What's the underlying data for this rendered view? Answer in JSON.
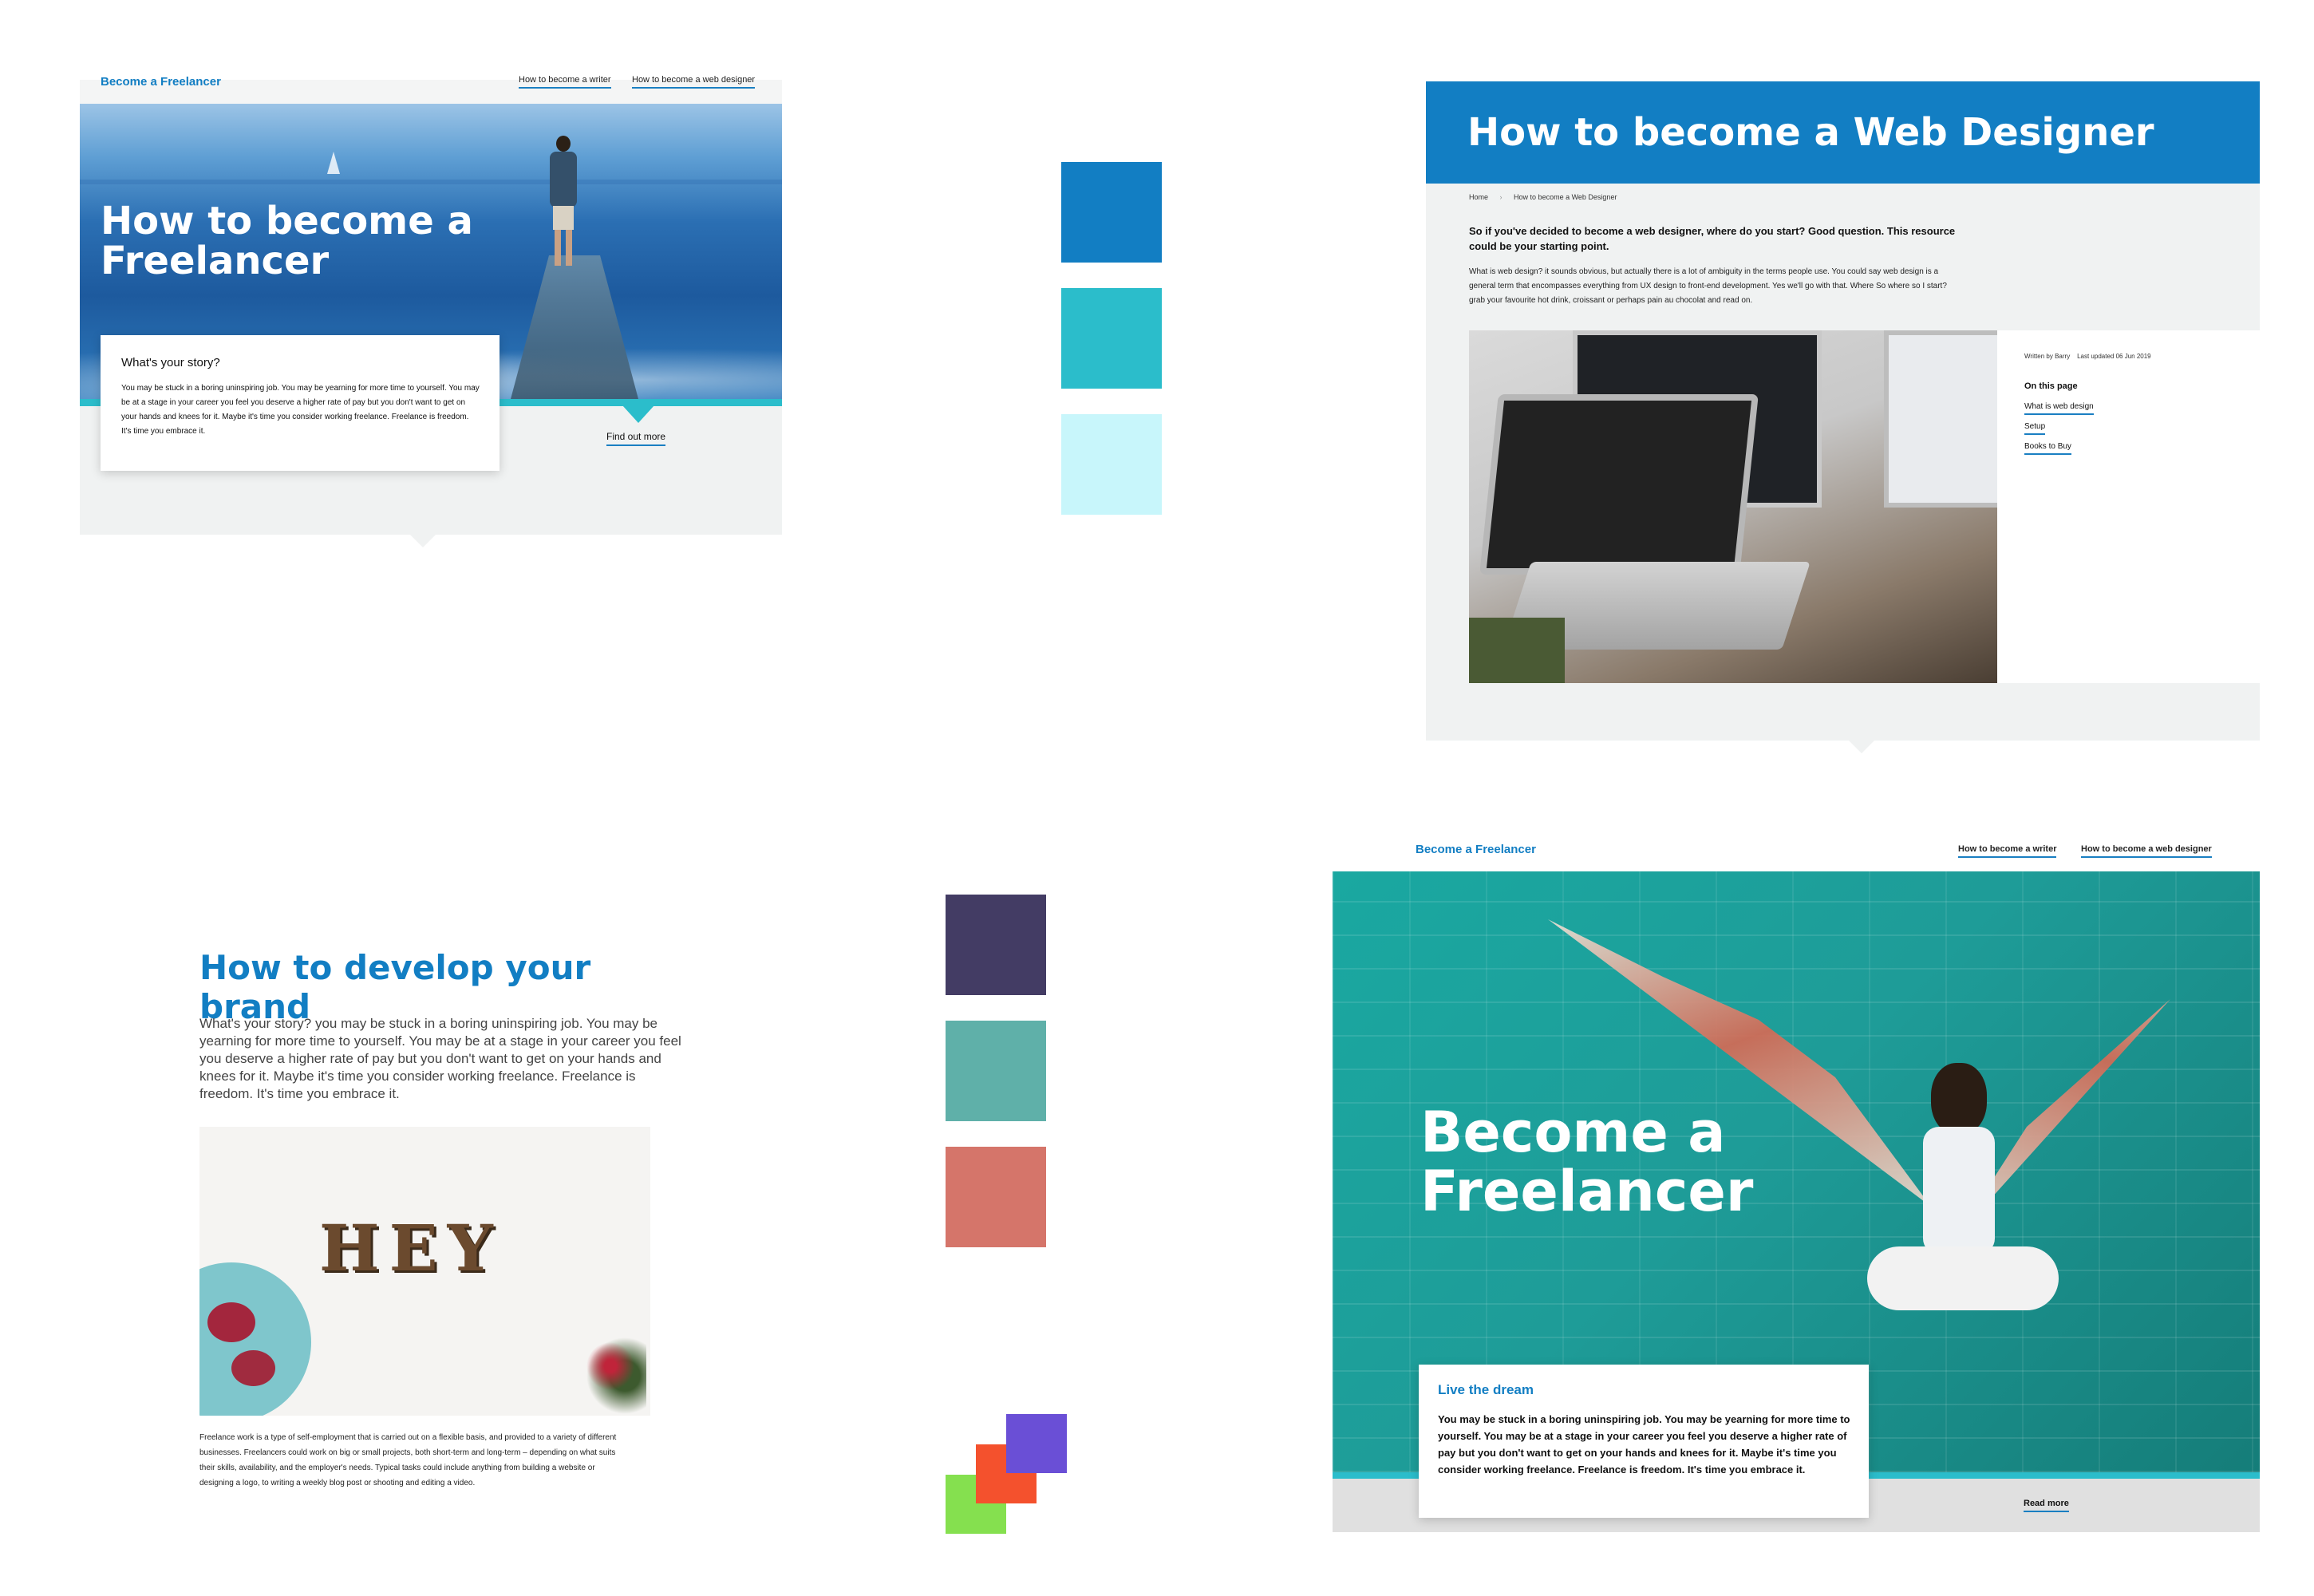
{
  "colors": {
    "brand_blue": "#127ec3",
    "teal": "#2bbdcb",
    "ice": "#c8f6fb",
    "navy": "#433c64",
    "sage": "#5fb0a9",
    "salmon": "#d5756a",
    "purple": "#6a4fd6",
    "orange": "#f4512d",
    "green": "#85e04f"
  },
  "mock1": {
    "brand": "Become a Freelancer",
    "nav": [
      "How to become a writer",
      "How to become a web designer"
    ],
    "hero_title_line1": "How to become a",
    "hero_title_line2": "Freelancer",
    "card_heading": "What's your story?",
    "card_body": "You may be stuck in a boring uninspiring job. You may be yearning for more time to yourself. You may be at a stage in your career you feel you deserve a higher rate of pay but you don't want to get on your hands and knees for it. Maybe it's time you consider working freelance. Freelance is freedom. It's time you embrace it.",
    "cta": "Find out more"
  },
  "mock2": {
    "title": "How to become a Web Designer",
    "breadcrumb": [
      "Home",
      "How to become a Web Designer"
    ],
    "intro": "So if you've decided to become a web designer, where do you start? Good question. This resource could be your starting point.",
    "body": "What is web design? it sounds obvious, but actually there is a lot of ambiguity in the terms people use. You could say web design is a general term that encompasses everything from UX design to front-end development. Yes we'll go with that. Where So where so I start? grab your favourite hot drink, croissant or perhaps pain au chocolat and read on.",
    "meta": "Written by Barry    Last updated 06 Jun 2019",
    "toc_heading": "On this page",
    "toc": [
      "What is web design",
      "Setup",
      "Books to Buy"
    ]
  },
  "mock3": {
    "title": "How to develop your brand",
    "lead": "What's your story? you may be stuck in a boring uninspiring job. You may be yearning for more time to yourself. You may be at a stage in your career you feel you deserve a higher rate of pay but you don't want to get on your hands and knees for it. Maybe it's time you consider working freelance. Freelance is freedom. It's time you embrace it.",
    "image_word": "HEY",
    "body": "Freelance work is a type of self-employment that is carried out on a flexible basis, and provided to a variety of different businesses. Freelancers could work on big or small projects, both short-term and long-term – depending on what suits their skills, availability, and the employer's needs. Typical tasks could include anything from building a website or designing a logo, to writing a weekly blog post or shooting and editing a video."
  },
  "mock4": {
    "brand": "Become a Freelancer",
    "nav": [
      "How to become a writer",
      "How to become a web designer"
    ],
    "hero_title_line1": "Become a",
    "hero_title_line2": "Freelancer",
    "card_heading": "Live the dream",
    "card_body": "You may be stuck in a boring uninspiring job. You may be yearning for more time to yourself. You may be at a stage in your career you feel you deserve a higher rate of pay but you don't want to get on your hands and knees for it. Maybe it's time you consider working freelance. Freelance is freedom. It's time you embrace it.",
    "cta": "Read more"
  }
}
